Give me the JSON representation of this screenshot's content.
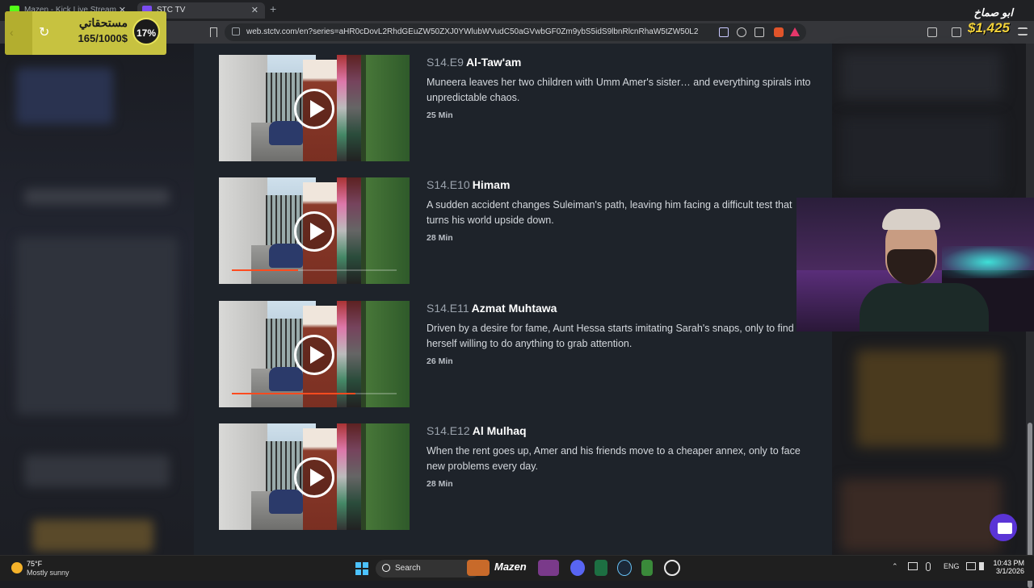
{
  "browser": {
    "tabs": [
      {
        "label": "Mazen - Kick Live Stream"
      },
      {
        "label": "STC TV"
      }
    ],
    "url": "web.stctv.com/en?series=aHR0cDovL2RhdGEuZW50ZXJ0YWlubWVudC50aGVwbGF0Zm9ybS5idS9lbnRlcnRhaW5tZW50L2RhdGEvVHZ..."
  },
  "episodes": [
    {
      "code": "S14.E9",
      "title": "Al-Taw'am",
      "description": "Muneera leaves her two children with Umm Amer's sister… and everything spirals into unpredictable chaos.",
      "duration": "25 Min",
      "progress": 0
    },
    {
      "code": "S14.E10",
      "title": "Himam",
      "description": "A sudden accident changes Suleiman's path, leaving him facing a difficult test that turns his world upside down.",
      "duration": "28 Min",
      "progress": 0.4
    },
    {
      "code": "S14.E11",
      "title": "Azmat Muhtawa",
      "description": "Driven by a desire for fame, Aunt Hessa starts imitating Sarah's snaps, only to find herself willing to do anything to grab attention.",
      "duration": "26 Min",
      "progress": 0.75
    },
    {
      "code": "S14.E12",
      "title": "Al Mulhaq",
      "description": "When the rent goes up, Amer and his friends move to a cheaper annex, only to face new problems every day.",
      "duration": "28 Min",
      "progress": 0
    }
  ],
  "overlay": {
    "donation_label": "مستحقاتي",
    "donation_amount": "165/1000$",
    "donation_percent": "17%",
    "top_right_name": "ابو صماخ",
    "top_right_amount": "$1,425"
  },
  "taskbar": {
    "temperature": "75°F",
    "condition": "Mostly sunny",
    "search_label": "Search",
    "streamer_name": "Mazen",
    "language": "ENG",
    "time": "10:43 PM",
    "date": "3/1/2026"
  },
  "colors": {
    "accent_progress": "#ff4b1f",
    "page_background": "#1e232a",
    "chat_button": "#5a34d6"
  }
}
